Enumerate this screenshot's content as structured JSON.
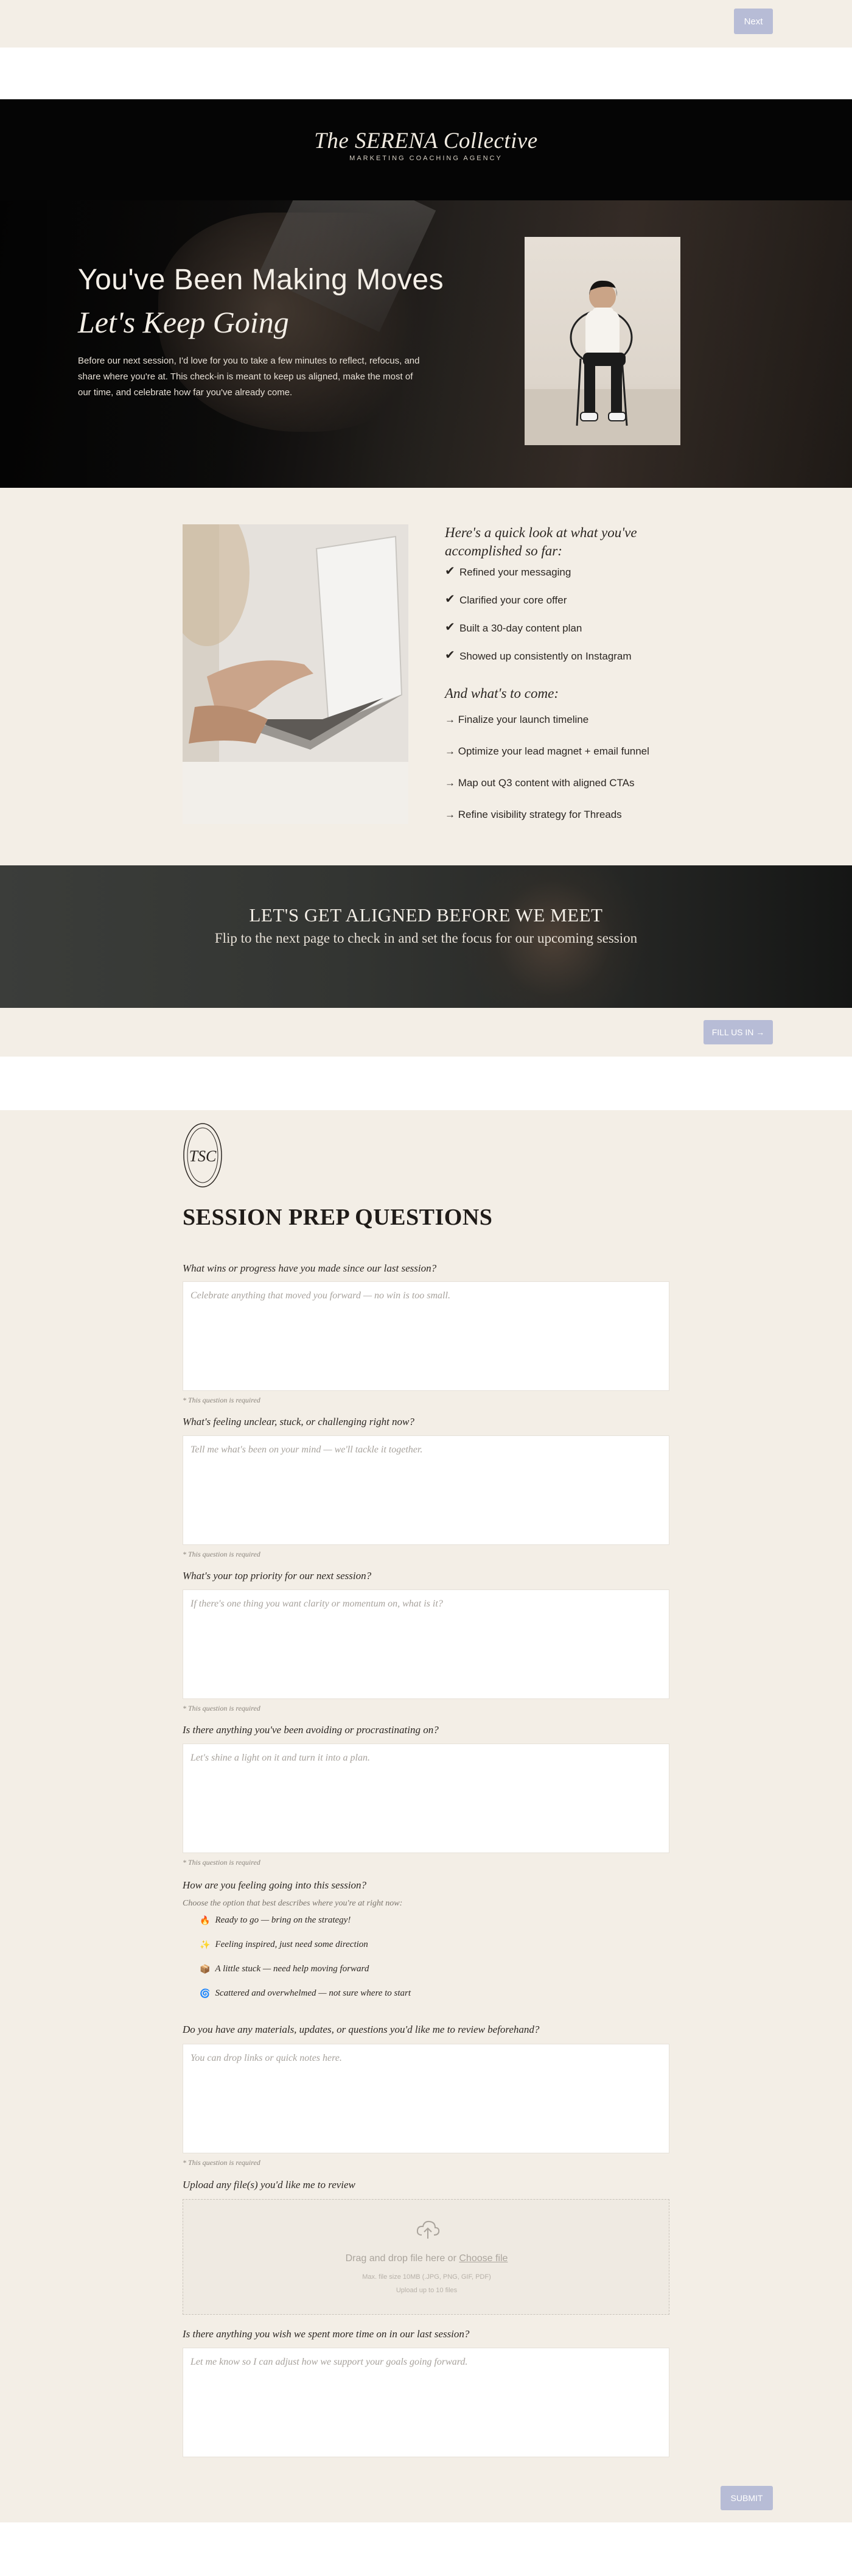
{
  "nav": {
    "next_label": "Next"
  },
  "hero": {
    "brand": "The SERENA Collective",
    "brand_sub": "MARKETING COACHING AGENCY",
    "title_line1": "You've Been Making Moves",
    "title_line2": "Let's Keep Going",
    "body": "Before our next session, I'd love for you to take a few minutes to reflect, refocus, and share where you're at. This check-in is meant to keep us aligned, make the most of our time, and celebrate how far you've already come."
  },
  "accomplished": {
    "heading": "Here's a quick look at what you've accomplished so far:",
    "check_mark": "✔",
    "items": [
      "Refined your messaging",
      "Clarified your core offer",
      "Built a 30-day content plan",
      "Showed up consistently on Instagram"
    ]
  },
  "to_come": {
    "heading": "And what's to come:",
    "items": [
      "→ Finalize your launch timeline",
      "→ Optimize your lead magnet + email funnel",
      "→ Map out Q3 content with aligned CTAs",
      "→ Refine visibility strategy for Threads"
    ]
  },
  "banner": {
    "title": "LET'S GET ALIGNED BEFORE WE MEET",
    "subtitle": "Flip to the next page to check in and set the focus for our upcoming session",
    "button_label": "FILL US IN →"
  },
  "form": {
    "seal_letters": "TSC",
    "title": "SESSION PREP QUESTIONS",
    "required_note": "* This question is required",
    "q1": {
      "label": "What wins or progress have you made since our last session?",
      "placeholder": "Celebrate anything that moved you forward — no win is too small."
    },
    "q2": {
      "label": "What's feeling unclear, stuck, or challenging right now?",
      "placeholder": "Tell me what's been on your mind — we'll tackle it together."
    },
    "q3": {
      "label": "What's your top priority for our next session?",
      "placeholder": "If there's one thing you want clarity or momentum on, what is it?"
    },
    "q4": {
      "label": "Is there anything you've been avoiding or procrastinating on?",
      "placeholder": "Let's shine a light on it and turn it into a plan."
    },
    "q5": {
      "label": "How are you feeling going into this session?",
      "hint": "Choose the option that best describes where you're at right now:",
      "options": [
        {
          "icon": "🔥",
          "label": "Ready to go — bring on the strategy!"
        },
        {
          "icon": "✨",
          "label": "Feeling inspired, just need some direction"
        },
        {
          "icon": "📦",
          "label": "A little stuck — need help moving forward"
        },
        {
          "icon": "🌀",
          "label": "Scattered and overwhelmed — not sure where to start"
        }
      ]
    },
    "q6": {
      "label": "Do you have any materials, updates, or questions you'd like me to review beforehand?",
      "placeholder": "You can drop links or quick notes here."
    },
    "upload": {
      "label": "Upload any file(s) you'd like me to review",
      "drop_text": "Drag and drop file here or",
      "choose_text": "Choose file",
      "formats": "Max. file size 10MB (.JPG, PNG, GIF, PDF)",
      "limit": "Upload up to 10 files"
    },
    "q7": {
      "label": "Is there anything you wish we spent more time on in our last session?",
      "placeholder": "Let me know so I can adjust how we support your goals going forward."
    },
    "submit_label": "SUBMIT"
  }
}
